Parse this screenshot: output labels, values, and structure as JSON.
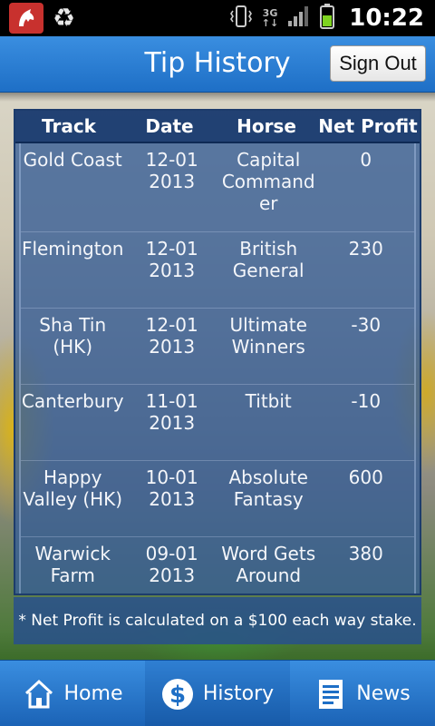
{
  "status_bar": {
    "network_type_top": "3G",
    "network_type_bottom": "↑↓",
    "time": "10:22"
  },
  "header": {
    "title": "Tip History",
    "sign_out_label": "Sign Out"
  },
  "table": {
    "columns": [
      "Track",
      "Date",
      "Horse",
      "Net Profit"
    ],
    "rows": [
      {
        "track": "Gold Coast",
        "date": "12-01\n2013",
        "horse": "Capital\nCommand\ner",
        "profit": "0"
      },
      {
        "track": "Flemington",
        "date": "12-01\n2013",
        "horse": "British\nGeneral",
        "profit": "230"
      },
      {
        "track": "Sha Tin\n(HK)",
        "date": "12-01\n2013",
        "horse": "Ultimate\nWinners",
        "profit": "-30"
      },
      {
        "track": "Canterbury",
        "date": "11-01\n2013",
        "horse": "Titbit",
        "profit": "-10"
      },
      {
        "track": "Happy\nValley (HK)",
        "date": "10-01\n2013",
        "horse": "Absolute\nFantasy",
        "profit": "600"
      },
      {
        "track": "Warwick\nFarm",
        "date": "09-01\n2013",
        "horse": "Word Gets\nAround",
        "profit": "380"
      }
    ]
  },
  "footnote": "* Net Profit is calculated on a $100 each way stake.",
  "nav": {
    "home": "Home",
    "history": "History",
    "news": "News",
    "active": "history"
  },
  "colors": {
    "accent": "#1e6fc6",
    "notification_red": "#c8312e",
    "battery_green": "#7ed321"
  },
  "icons": {
    "app_notification": "horse-logo-icon",
    "sync": "recycle-icon",
    "vibrate": "vibrate-icon",
    "signal": "signal-icon",
    "battery": "battery-icon",
    "home": "home-icon",
    "history": "dollar-icon",
    "news": "document-icon"
  }
}
